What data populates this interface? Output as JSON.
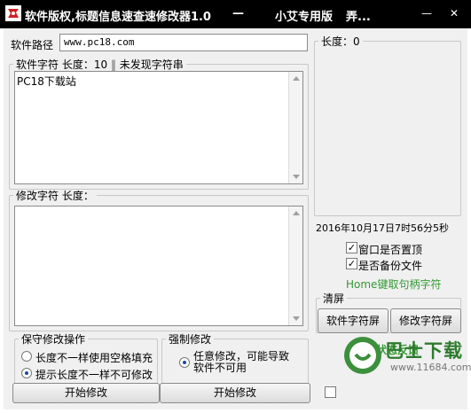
{
  "titlebar": {
    "title": "软件版权,标题信息速查速修改器1.0",
    "separator": "—",
    "edition": "小艾专用版",
    "more": "弄...",
    "minimize": "—",
    "close": "✕"
  },
  "path": {
    "label": "软件路径",
    "value": "www.pc18.com"
  },
  "software_string": {
    "legend": "软件字符",
    "length_label": "长度：10",
    "status": "未发现字符串",
    "content": "PC18下载站"
  },
  "modify_string": {
    "legend": "修改字符",
    "length_label": "长度：",
    "content": ""
  },
  "right_panel": {
    "length_label": "长度：0",
    "datetime": "2016年10月17日7时56分5秒",
    "topmost_label": "窗口是否置顶",
    "topmost_checked": true,
    "backup_label": "是否备份文件",
    "backup_checked": true,
    "home_hint": "Home键取句柄字符"
  },
  "clear_screen": {
    "legend": "清屏",
    "software_button": "软件字符屏",
    "modify_button": "修改字符屏"
  },
  "status_feedback": "操作状态反馈",
  "safe_modify": {
    "legend": "保守修改操作",
    "option1": "长度不一样使用空格填充",
    "option1_selected": false,
    "option2": "提示长度不一样不可修改",
    "option2_selected": true,
    "start_button": "开始修改"
  },
  "force_modify": {
    "legend": "强制修改",
    "option1": "任意修改，可能导致软件不可用",
    "option1_selected": true,
    "start_button": "开始修改"
  },
  "watermark": {
    "brand": "巴士下载",
    "url": "www.11684.com"
  },
  "colors": {
    "titlebar": "#000000",
    "client_bg": "#f0f0f0",
    "hint_green": "#339933",
    "watermark_green": "#2d7a2d"
  }
}
